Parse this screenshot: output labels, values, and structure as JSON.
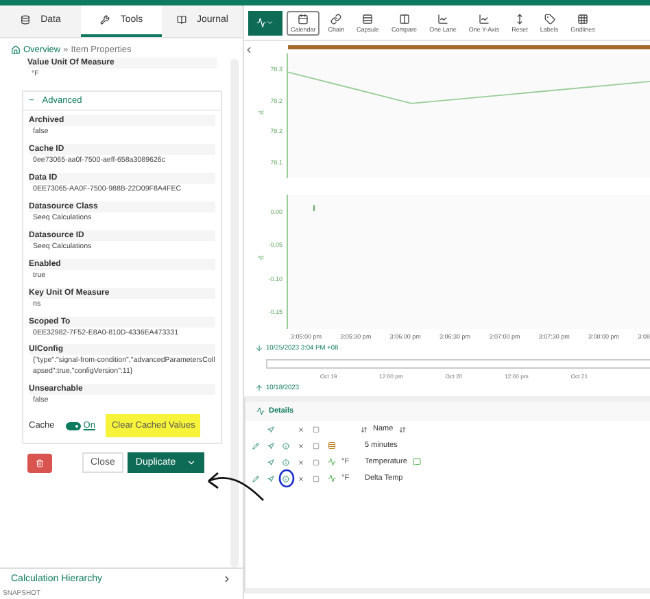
{
  "tabs": [
    {
      "label": "Data",
      "selected": false
    },
    {
      "label": "Tools",
      "selected": true
    },
    {
      "label": "Journal",
      "selected": false
    }
  ],
  "breadcrumb": {
    "home": "Overview",
    "separator": "»",
    "current": "Item Properties"
  },
  "top_property": {
    "label": "Value Unit Of Measure",
    "value": "°F"
  },
  "advanced": {
    "toggle": "−",
    "title": "Advanced",
    "properties": [
      {
        "label": "Archived",
        "value": "false"
      },
      {
        "label": "Cache ID",
        "value": "0ee73065-aa0f-7500-aeff-658a3089626c"
      },
      {
        "label": "Data ID",
        "value": "0EE73065-AA0F-7500-988B-22D09F8A4FEC"
      },
      {
        "label": "Datasource Class",
        "value": "Seeq Calculations"
      },
      {
        "label": "Datasource ID",
        "value": "Seeq Calculations"
      },
      {
        "label": "Enabled",
        "value": "true"
      },
      {
        "label": "Key Unit Of Measure",
        "value": "ns"
      },
      {
        "label": "Scoped To",
        "value": "0EE32982-7F52-E8A0-810D-4336EA473331"
      },
      {
        "label": "UIConfig",
        "value": "{\"type\":\"signal-from-condition\",\"advancedParametersCollapsed\":true,\"configVersion\":11}"
      },
      {
        "label": "Unsearchable",
        "value": "false"
      }
    ],
    "cache": {
      "label": "Cache",
      "on": true,
      "state_label": "On",
      "button": "Clear Cached Values",
      "highlighted": true
    }
  },
  "actions": {
    "close": "Close",
    "duplicate": "Duplicate"
  },
  "calculation_hierarchy": "Calculation Hierarchy",
  "toolbar": [
    {
      "label": "Calendar",
      "selected": true
    },
    {
      "label": "Chain",
      "selected": false
    },
    {
      "label": "Capsule",
      "selected": false
    },
    {
      "label": "Compare",
      "selected": false
    },
    {
      "label": "One Lane",
      "selected": false
    },
    {
      "label": "One Y-Axis",
      "selected": false
    },
    {
      "label": "Reset",
      "selected": false
    },
    {
      "label": "Labels",
      "selected": false
    },
    {
      "label": "Gridlines",
      "selected": false
    }
  ],
  "trend_top": {
    "unit": "°F",
    "y_ticks": [
      "78.3",
      "78.2",
      "78.2",
      "78.1"
    ]
  },
  "trend_bottom": {
    "unit": "°F",
    "y_ticks": [
      "0.00",
      "-0.05",
      "-0.10",
      "-0.15"
    ],
    "x_ticks": [
      "3:05:00 pm",
      "3:05:30 pm",
      "3:06:00 pm",
      "3:06:30 pm",
      "3:07:00 pm",
      "3:07:30 pm",
      "3:08:00 pm",
      "3:08"
    ]
  },
  "end_time": "10/25/2023 3:04 PM  +08",
  "navigator_ticks": [
    "Oct 19",
    "12:00 pm",
    "Oct 20",
    "12:00 pm",
    "Oct 21"
  ],
  "start_time": "10/18/2023",
  "details": {
    "title": "Details",
    "header": "Name",
    "all_checked": false,
    "rows": [
      {
        "name": "5 minutes",
        "kind": "condition",
        "edit": true,
        "comment": false,
        "circled": false,
        "checked": false
      },
      {
        "name": "Temperature",
        "kind": "signal",
        "unit": "°F",
        "edit": false,
        "comment": true,
        "circled": false,
        "checked": false
      },
      {
        "name": "Delta Temp",
        "kind": "signal",
        "unit": "°F",
        "edit": true,
        "comment": false,
        "circled": true,
        "checked": false
      }
    ]
  },
  "footer": "SNAPSHOT"
}
